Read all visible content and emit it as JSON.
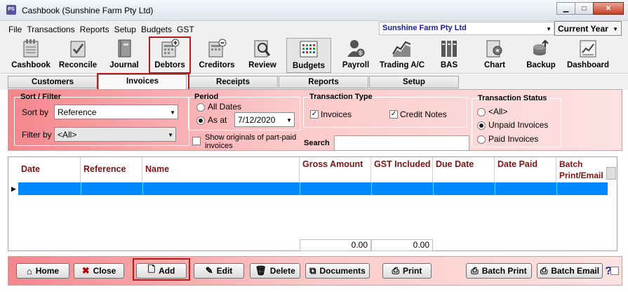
{
  "window": {
    "title": "Cashbook (Sunshine Farm Pty Ltd)",
    "icon_text": "PS"
  },
  "menu": [
    "File",
    "Transactions",
    "Reports",
    "Setup",
    "Budgets",
    "GST"
  ],
  "company": {
    "name": "Sunshine Farm Pty Ltd"
  },
  "year": {
    "selected": "Current Year"
  },
  "toolbar": [
    {
      "label": "Cashbook",
      "icon": "cashbook-icon"
    },
    {
      "label": "Reconcile",
      "icon": "reconcile-icon"
    },
    {
      "label": "Journal",
      "icon": "journal-icon"
    },
    {
      "label": "Debtors",
      "icon": "debtors-icon"
    },
    {
      "label": "Creditors",
      "icon": "creditors-icon"
    },
    {
      "label": "Review",
      "icon": "review-icon"
    },
    {
      "label": "Budgets",
      "icon": "budgets-icon"
    },
    {
      "label": "Payroll",
      "icon": "payroll-icon"
    },
    {
      "label": "Trading A/C",
      "icon": "trading-icon"
    },
    {
      "label": "BAS",
      "icon": "bas-icon"
    },
    {
      "label": "Chart",
      "icon": "chart-icon"
    },
    {
      "label": "Backup",
      "icon": "backup-icon"
    },
    {
      "label": "Dashboard",
      "icon": "dashboard-icon"
    }
  ],
  "tabs": [
    "Customers",
    "Invoices",
    "Receipts",
    "Reports",
    "Setup"
  ],
  "sort_filter": {
    "title": "Sort / Filter",
    "sort_label": "Sort by",
    "sort_value": "Reference",
    "filter_label": "Filter by",
    "filter_value": "<All>"
  },
  "period": {
    "title": "Period",
    "all_dates": "All Dates",
    "as_at": "As at",
    "date": "7/12/2020",
    "show_originals": "Show originals of part-paid invoices"
  },
  "transaction_type": {
    "title": "Transaction Type",
    "invoices": "Invoices",
    "credit_notes": "Credit Notes"
  },
  "search": {
    "label": "Search",
    "value": ""
  },
  "transaction_status": {
    "title": "Transaction Status",
    "all": "<All>",
    "unpaid": "Unpaid Invoices",
    "paid": "Paid Invoices"
  },
  "grid": {
    "columns": [
      "Date",
      "Reference",
      "Name",
      "Gross Amount",
      "GST Included",
      "Due Date",
      "Date Paid",
      "Batch Print/Email"
    ],
    "totals": {
      "gross": "0.00",
      "gst": "0.00"
    }
  },
  "buttons": {
    "home": "Home",
    "close": "Close",
    "add": "Add",
    "edit": "Edit",
    "delete": "Delete",
    "documents": "Documents",
    "print": "Print",
    "batch_print": "Batch Print",
    "batch_email": "Batch Email"
  }
}
